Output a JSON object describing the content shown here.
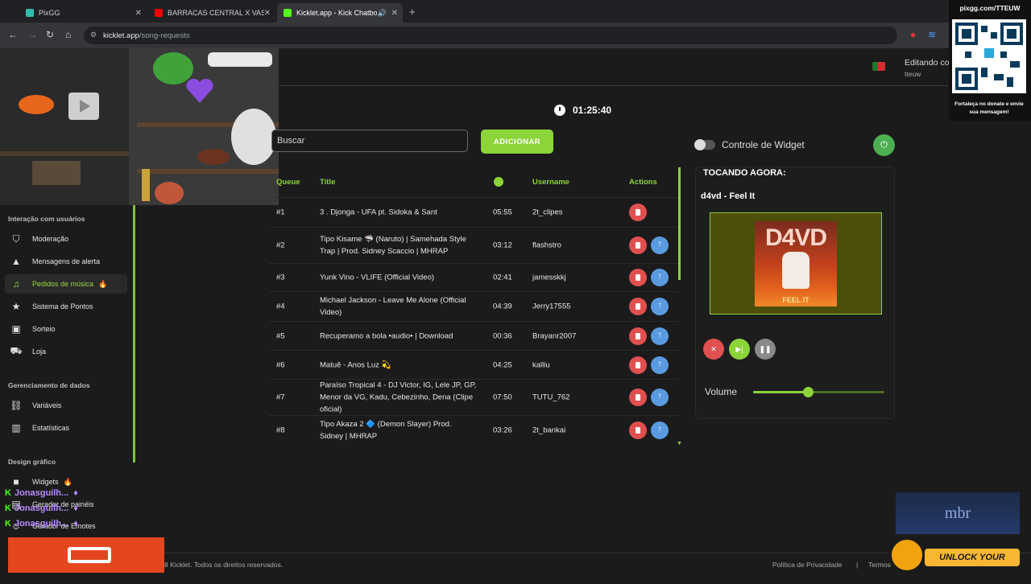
{
  "browser": {
    "tabs": [
      {
        "label": "PixGG"
      },
      {
        "label": "BARRACAS CENTRAL X VASCO"
      },
      {
        "label": "Kicklet.app - Kick Chatbot a"
      }
    ],
    "url_host": "kicklet.app",
    "url_path": "/song-requests"
  },
  "header": {
    "editing": "Editando co",
    "user": "tteuw"
  },
  "sidebar": {
    "sections": [
      {
        "title": "Interação com usuários"
      },
      {
        "title": "Gerenciamento de dados"
      },
      {
        "title": "Design gráfico"
      }
    ],
    "items": [
      {
        "label": "Moderação",
        "icon": "shield-icon"
      },
      {
        "label": "Mensagens de alerta",
        "icon": "warning-icon"
      },
      {
        "label": "Pedidos de música",
        "icon": "music-icon",
        "badge": "🔥",
        "active": true
      },
      {
        "label": "Sistema de Pontos",
        "icon": "star-icon"
      },
      {
        "label": "Sorteio",
        "icon": "gift-icon"
      },
      {
        "label": "Loja",
        "icon": "cart-icon"
      },
      {
        "label": "Variáveis",
        "icon": "link-icon"
      },
      {
        "label": "Estatísticas",
        "icon": "chart-icon"
      },
      {
        "label": "Widgets",
        "icon": "video-icon",
        "badge": "🔥"
      },
      {
        "label": "Gerador de painéis",
        "icon": "panel-icon"
      },
      {
        "label": "Gerador de Emotes",
        "icon": "emote-icon"
      }
    ]
  },
  "player": {
    "timer": "01:25:40",
    "search_placeholder": "Buscar",
    "add_label": "ADICIONAR",
    "widget_control_label": "Controle de Widget",
    "now_playing_header": "TOCANDO AGORA:",
    "now_playing_title": "d4vd - Feel It",
    "cover_brand": "D4VD",
    "cover_subtitle": "FEEL IT",
    "volume_label": "Volume",
    "volume": 0.42
  },
  "table": {
    "headers": {
      "queue": "Queue",
      "title": "Title",
      "username": "Username",
      "actions": "Actions"
    },
    "rows": [
      {
        "queue": "#1",
        "title": "3 . Djonga - UFA pt. Sidoka & Sant",
        "duration": "05:55",
        "username": "2t_clipes",
        "up": false
      },
      {
        "queue": "#2",
        "title": "Tipo Kisame 🦈 (Naruto) | Samehada Style Trap | Prod. Sidney Scaccio | MHRAP",
        "duration": "03:12",
        "username": "flashstro",
        "up": true
      },
      {
        "queue": "#3",
        "title": "Yunk Vino - VLIFE (Official Video)",
        "duration": "02:41",
        "username": "jamesskkj",
        "up": true
      },
      {
        "queue": "#4",
        "title": "Michael Jackson - Leave Me Alone (Official Video)",
        "duration": "04:39",
        "username": "Jerry17555",
        "up": true
      },
      {
        "queue": "#5",
        "title": "Recuperamo a bola •audio• | Download",
        "duration": "00:36",
        "username": "Brayanr2007",
        "up": true
      },
      {
        "queue": "#6",
        "title": "Matuê - Anos Luz 💫",
        "duration": "04:25",
        "username": "kalliu",
        "up": true
      },
      {
        "queue": "#7",
        "title": "Paraíso Tropical 4 - DJ Victor, IG, Lele JP, GP, Menor da VG, Kadu, Cebezinho, Dena (Clipe oficial)",
        "duration": "07:50",
        "username": "TUTU_762",
        "up": true
      },
      {
        "queue": "#8",
        "title": "Tipo Akaza 2 🔷 (Demon Slayer) Prod. Sidney | MHRAP",
        "duration": "03:26",
        "username": "2t_bankai",
        "up": true
      }
    ]
  },
  "footer": {
    "copyright": "8 Kicklet. Todos os direitos reservados.",
    "privacy": "Política de Privacidade",
    "separator": "|",
    "terms": "Termos"
  },
  "overlay": {
    "qr_url": "pixgg.com/TTEUW",
    "qr_message": "Fortaleça no donate e envie sua mensagem!",
    "chat": [
      {
        "user": "Jonasguilh..."
      },
      {
        "user": "Jonasguilh..."
      },
      {
        "user": "Jonasguilh..."
      }
    ],
    "mbr_text": "mbr",
    "unlock_label": "UNLOCK YOUR BONUS"
  },
  "colors": {
    "accent": "#8bd43a",
    "delete": "#e05050",
    "move_up": "#5a9be0",
    "background": "#1b1b1c"
  }
}
